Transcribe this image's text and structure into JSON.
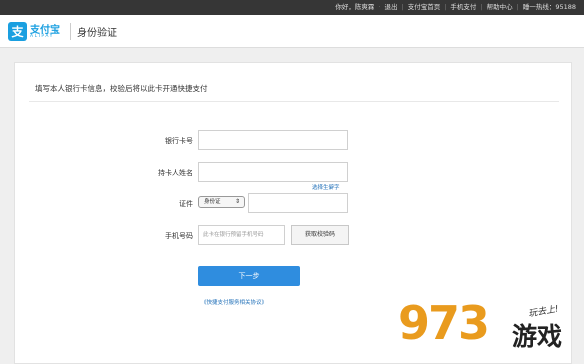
{
  "topbar": {
    "greeting": "你好，陈爽霖",
    "logout": "退出",
    "home": "支付宝首页",
    "mobile": "手机支付",
    "help": "帮助中心",
    "hotline": "睡一热线：95188"
  },
  "header": {
    "logo_text": "支付宝",
    "logo_en": "ALIPAY",
    "logo_mark": "支",
    "title": "身份验证"
  },
  "panel": {
    "heading": "填写本人银行卡信息，校验后将以此卡开通快捷支付"
  },
  "form": {
    "card_label": "银行卡号",
    "card_value": "",
    "name_label": "持卡人姓名",
    "name_value": "",
    "rare_char_link": "选择生僻字",
    "id_label": "证件",
    "id_type": "身份证",
    "id_value": "",
    "phone_label": "手机号码",
    "phone_placeholder": "此卡在银行预留手机号码",
    "get_code": "获取校验码",
    "next": "下一步",
    "agreement": "《快捷支付服务相关协议》"
  },
  "watermark": {
    "number": "973",
    "site": "游戏",
    "script": "玩去上!"
  },
  "colors": {
    "brand": "#1a9fe0",
    "button": "#2f8ddf",
    "link": "#1f6fb8",
    "topbar": "#363636"
  }
}
